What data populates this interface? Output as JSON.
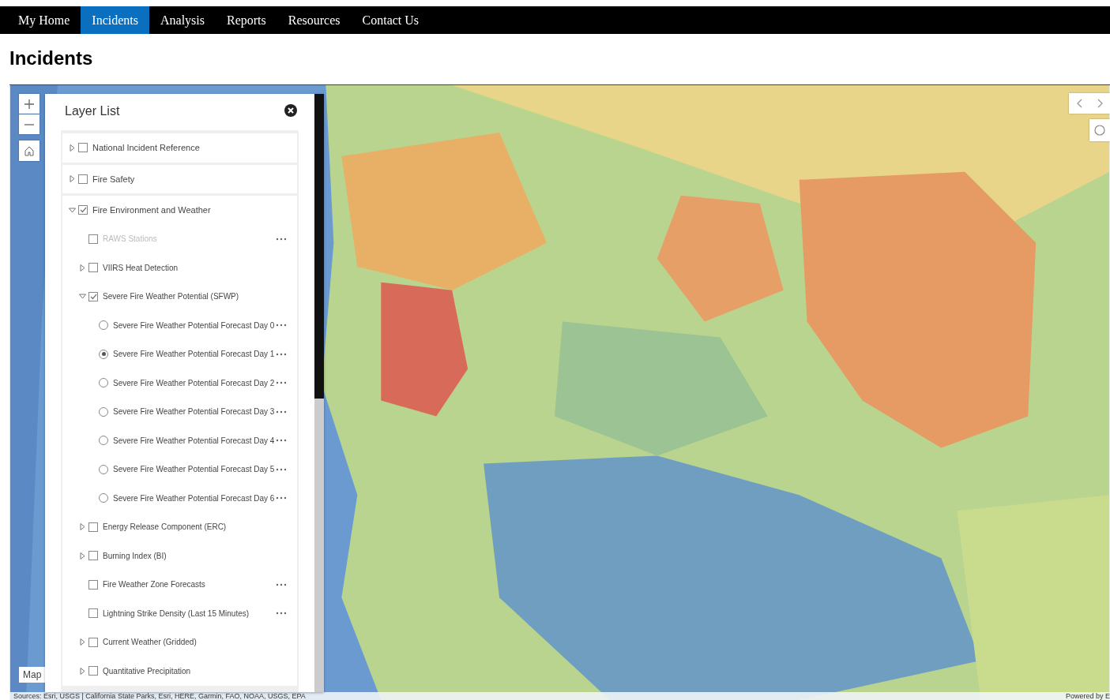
{
  "nav": {
    "tabs": [
      {
        "label": "My Home",
        "selected": false
      },
      {
        "label": "Incidents",
        "selected": true
      },
      {
        "label": "Analysis",
        "selected": false
      },
      {
        "label": "Reports",
        "selected": false
      },
      {
        "label": "Resources",
        "selected": false
      },
      {
        "label": "Contact Us",
        "selected": false
      }
    ]
  },
  "page_title": "Incidents",
  "map": {
    "kind": "picture",
    "map_label": "Map",
    "attribution": "Sources: Esri, USGS | California State Parks, Esri, HERE, Garmin, FAO, NOAA, USGS, EPA",
    "powered_by": "Powered by E"
  },
  "layer_list": {
    "title": "Layer List",
    "items": [
      {
        "kind": "folder",
        "label": "National Incident Reference",
        "checked": false,
        "expanded": false
      },
      {
        "kind": "folder",
        "label": "Fire Safety",
        "checked": false,
        "expanded": false
      },
      {
        "kind": "folder",
        "label": "Fire Environment and Weather",
        "checked": true,
        "expanded": true,
        "children": [
          {
            "kind": "layer",
            "label": "RAWS Stations",
            "checked": false,
            "disabled": true,
            "options": true
          },
          {
            "kind": "folder",
            "label": "VIIRS Heat Detection",
            "checked": false,
            "expanded": false,
            "disabled": false,
            "options": false
          },
          {
            "kind": "folder",
            "label": "Severe Fire Weather Potential (SFWP)",
            "checked": true,
            "expanded": true,
            "disabled": false,
            "options": false,
            "children": [
              {
                "kind": "radio",
                "label": "Severe Fire Weather Potential Forecast Day 0",
                "selected": false,
                "options": true
              },
              {
                "kind": "radio",
                "label": "Severe Fire Weather Potential Forecast Day 1",
                "selected": true,
                "options": true
              },
              {
                "kind": "radio",
                "label": "Severe Fire Weather Potential Forecast Day 2",
                "selected": false,
                "options": true
              },
              {
                "kind": "radio",
                "label": "Severe Fire Weather Potential Forecast Day 3",
                "selected": false,
                "options": true
              },
              {
                "kind": "radio",
                "label": "Severe Fire Weather Potential Forecast Day 4",
                "selected": false,
                "options": true
              },
              {
                "kind": "radio",
                "label": "Severe Fire Weather Potential Forecast Day 5",
                "selected": false,
                "options": true
              },
              {
                "kind": "radio",
                "label": "Severe Fire Weather Potential Forecast Day 6",
                "selected": false,
                "options": true
              }
            ]
          },
          {
            "kind": "folder",
            "label": "Energy Release Component (ERC)",
            "checked": false,
            "expanded": false,
            "disabled": false,
            "options": false
          },
          {
            "kind": "folder",
            "label": "Burning Index (BI)",
            "checked": false,
            "expanded": false,
            "disabled": false,
            "options": false
          },
          {
            "kind": "layer",
            "label": "Fire Weather Zone Forecasts",
            "checked": false,
            "disabled": false,
            "options": true
          },
          {
            "kind": "layer",
            "label": "Lightning Strike Density (Last 15 Minutes)",
            "checked": false,
            "disabled": false,
            "options": true
          },
          {
            "kind": "folder",
            "label": "Current Weather (Gridded)",
            "checked": false,
            "expanded": false,
            "disabled": false,
            "options": false
          },
          {
            "kind": "folder",
            "label": "Quantitative Precipitation",
            "checked": false,
            "expanded": false,
            "disabled": false,
            "options": false
          }
        ]
      }
    ]
  }
}
